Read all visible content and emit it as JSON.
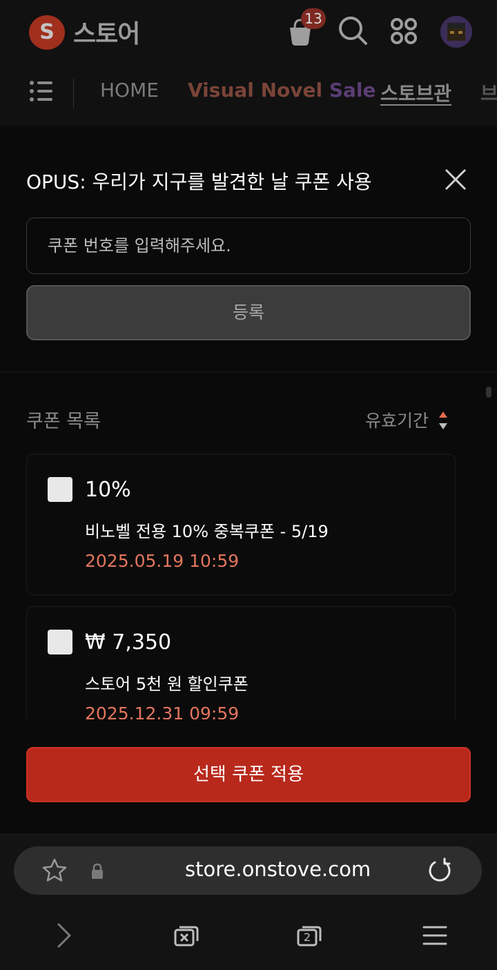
{
  "header": {
    "logo_letter": "S",
    "title": "스토어",
    "cart_badge": "13",
    "icons": [
      "cart-icon",
      "search-icon",
      "apps-grid-icon",
      "avatar"
    ]
  },
  "nav": {
    "items": [
      "HOME",
      "Visual Novel",
      "Sale",
      "스토브관",
      "브"
    ]
  },
  "sheet": {
    "title": "OPUS: 우리가 지구를 발견한 날 쿠폰 사용",
    "input_placeholder": "쿠폰 번호를 입력해주세요.",
    "register_label": "등록",
    "list_label": "쿠폰 목록",
    "sort_label": "유효기간",
    "coupons": [
      {
        "amount": "10%",
        "name": "비노벨 전용 10% 중복쿠폰 - 5/19",
        "expires": "2025.05.19 10:59",
        "checked": false
      },
      {
        "amount": "₩ 7,350",
        "name": "스토어 5천 원 할인쿠폰",
        "expires": "2025.12.31 09:59",
        "checked": false
      }
    ],
    "apply_label": "선택 쿠폰 적용"
  },
  "browser": {
    "url": "store.onstove.com",
    "tab_count": "2"
  },
  "colors": {
    "accent": "#b8291c",
    "date_text": "#e3765e",
    "background": "#0a0a0a"
  }
}
